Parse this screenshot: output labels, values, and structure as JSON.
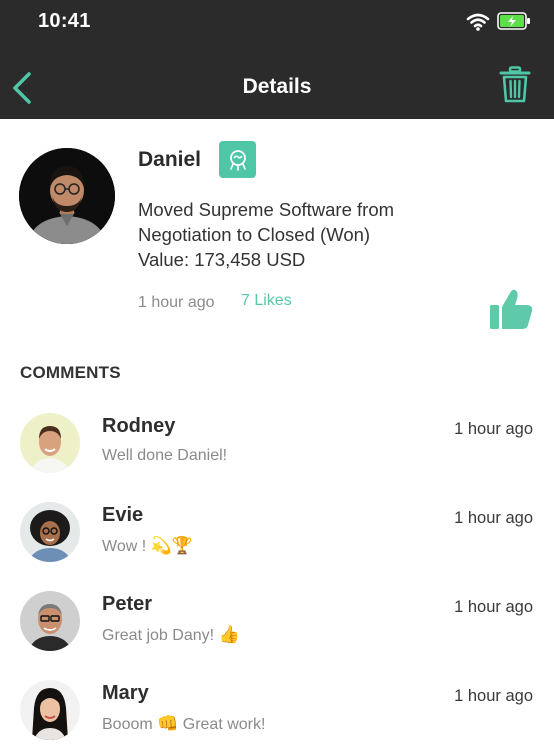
{
  "status_bar": {
    "time": "10:41"
  },
  "header": {
    "title": "Details"
  },
  "post": {
    "author": "Daniel",
    "lines": [
      "Moved Supreme Software from",
      "Negotiation to Closed (Won)",
      "Value: 173,458 USD"
    ],
    "time": "1 hour ago",
    "likes": "7 Likes"
  },
  "comments_label": "COMMENTS",
  "comments": [
    {
      "name": "Rodney",
      "time": "1 hour ago",
      "text": "Well done Daniel!",
      "emoji": ""
    },
    {
      "name": "Evie",
      "time": "1 hour ago",
      "text": "Wow ! ",
      "emoji": "💫🏆"
    },
    {
      "name": "Peter",
      "time": "1 hour ago",
      "text": "Great job Dany! ",
      "emoji": "👍"
    },
    {
      "name": "Mary",
      "time": "1 hour ago",
      "text": "Booom ",
      "emoji": "👊",
      "text_after": " Great work!"
    }
  ],
  "colors": {
    "header_bg": "#2b2b2c",
    "accent": "#4fc7a7",
    "likes": "#55c9a9"
  },
  "icons": [
    "back-chevron-icon",
    "trash-icon",
    "wifi-icon",
    "battery-icon",
    "deal-icon",
    "thumbs-up-icon"
  ]
}
